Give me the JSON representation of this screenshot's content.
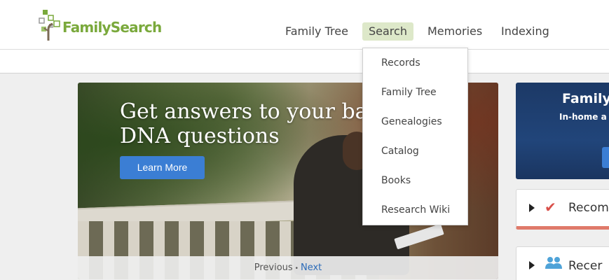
{
  "header": {
    "logo_text": "FamilySearch",
    "nav": [
      {
        "label": "Family Tree"
      },
      {
        "label": "Search"
      },
      {
        "label": "Memories"
      },
      {
        "label": "Indexing"
      }
    ]
  },
  "search_menu": {
    "items": [
      {
        "label": "Records"
      },
      {
        "label": "Family Tree"
      },
      {
        "label": "Genealogies"
      },
      {
        "label": "Catalog"
      },
      {
        "label": "Books"
      },
      {
        "label": "Research Wiki"
      }
    ]
  },
  "hero": {
    "title": "Get answers to your basic DNA questions",
    "button_label": "Learn More",
    "pager_prev": "Previous",
    "pager_separator": "•",
    "pager_next": "Next"
  },
  "side": {
    "promo_title": "Family",
    "promo_subtitle": "In-home a",
    "cards": [
      {
        "label": "Recom",
        "icon": "check-icon"
      },
      {
        "label": "Recer",
        "icon": "people-icon"
      }
    ]
  },
  "colors": {
    "brand_green": "#7aa93c",
    "active_nav_bg": "#dde8c9",
    "button_blue": "#3b7ed4",
    "link_blue": "#2a6ab8"
  }
}
